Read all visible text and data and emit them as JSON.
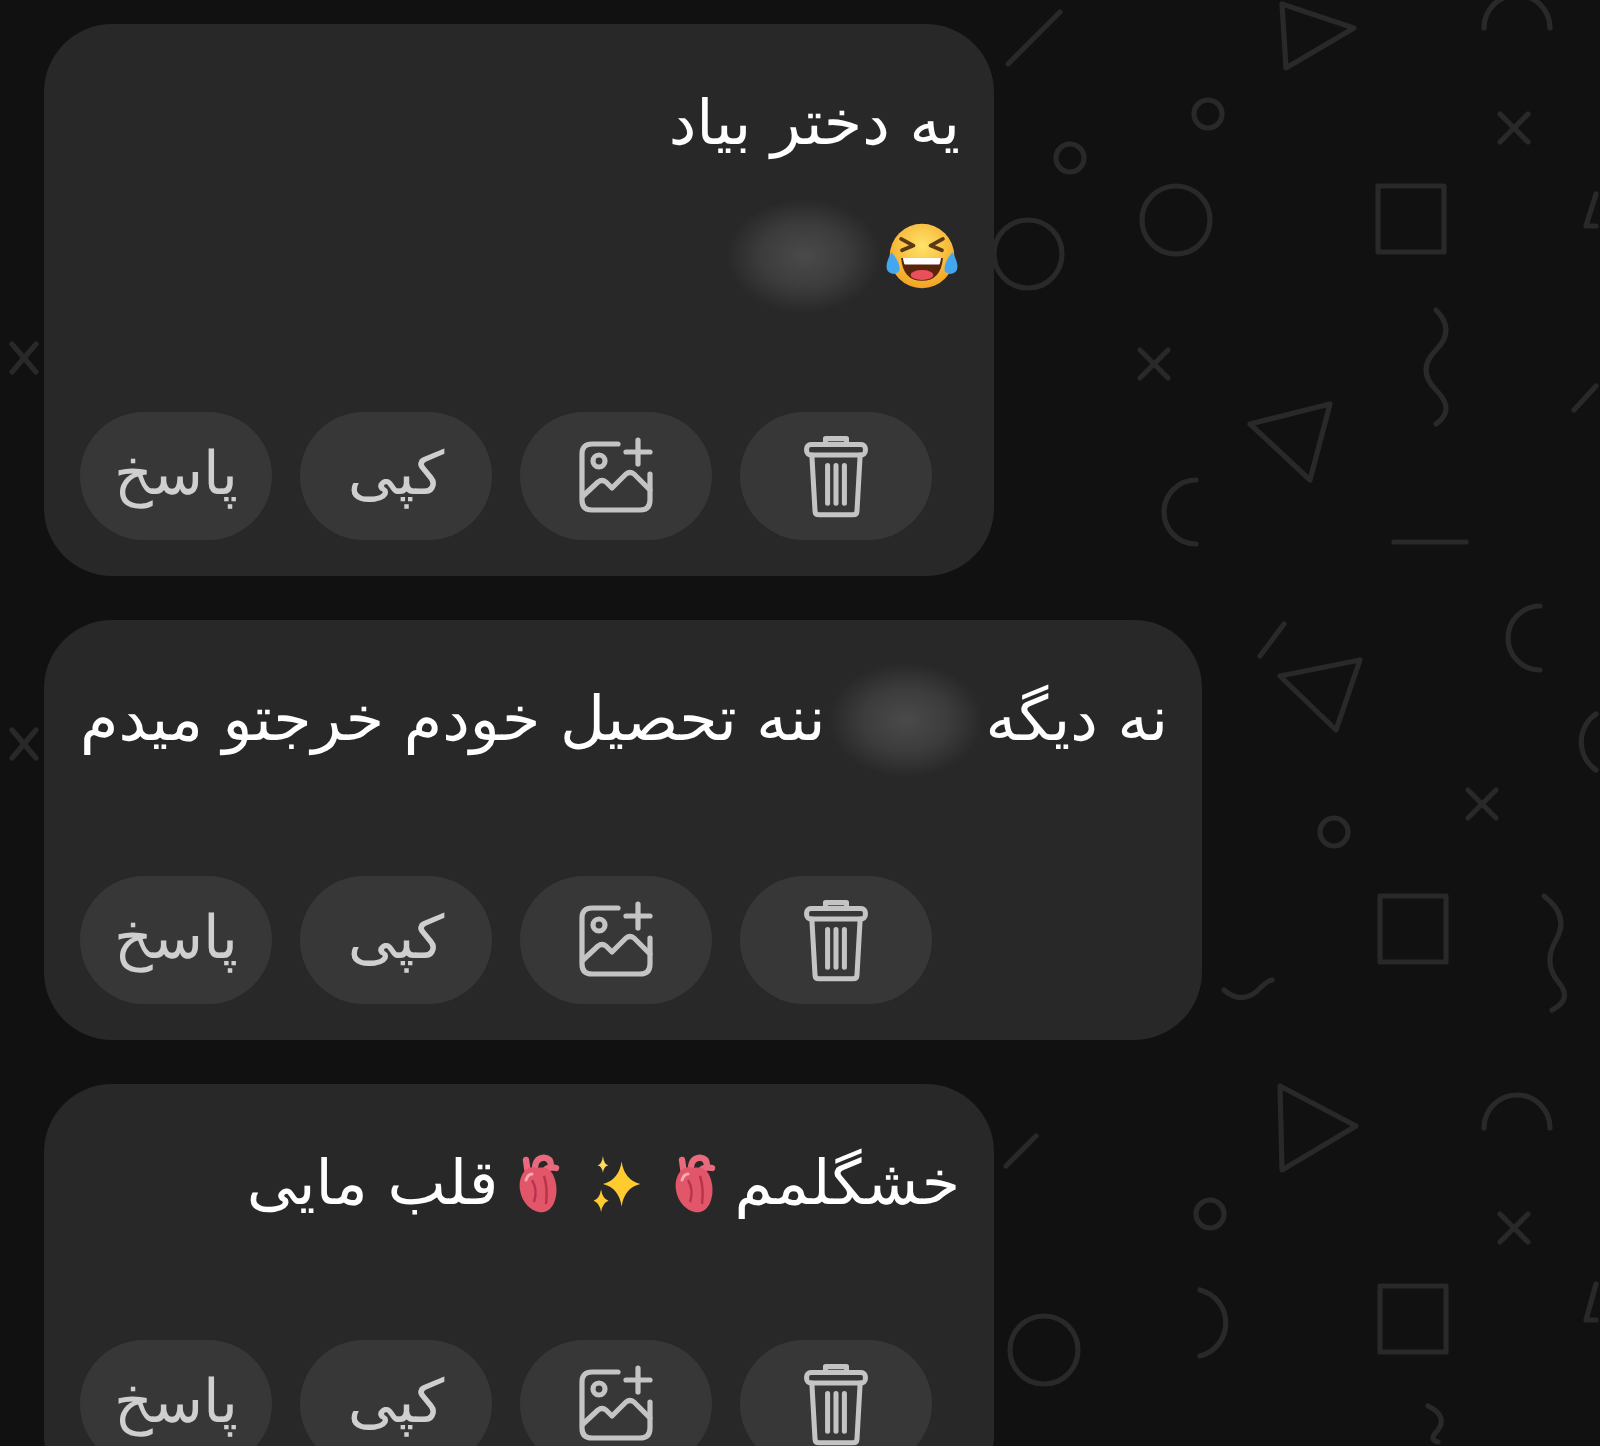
{
  "messages": [
    {
      "lines": [
        [
          {
            "kind": "text",
            "text": "یه دختر بیاد"
          }
        ],
        [
          {
            "kind": "laughing"
          },
          {
            "kind": "blur"
          }
        ]
      ],
      "actions": [
        {
          "kind": "delete"
        },
        {
          "kind": "image"
        },
        {
          "kind": "copy",
          "label": "کپی"
        },
        {
          "kind": "reply",
          "label": "پاسخ"
        }
      ]
    },
    {
      "lines": [
        [
          {
            "kind": "text",
            "text": "نه دیگه"
          },
          {
            "kind": "blur"
          },
          {
            "kind": "text",
            "text": "ننه تحصیل خودم خرجتو میدم"
          }
        ]
      ],
      "actions": [
        {
          "kind": "delete"
        },
        {
          "kind": "image"
        },
        {
          "kind": "copy",
          "label": "کپی"
        },
        {
          "kind": "reply",
          "label": "پاسخ"
        }
      ]
    },
    {
      "lines": [
        [
          {
            "kind": "text",
            "text": "خشگلمم"
          },
          {
            "kind": "heart"
          },
          {
            "kind": "sparkles"
          },
          {
            "kind": "heart"
          },
          {
            "kind": "text",
            "text": "قلب مایی"
          }
        ]
      ],
      "actions": [
        {
          "kind": "delete"
        },
        {
          "kind": "image"
        },
        {
          "kind": "copy",
          "label": "کپی"
        },
        {
          "kind": "reply",
          "label": "پاسخ"
        }
      ]
    }
  ]
}
